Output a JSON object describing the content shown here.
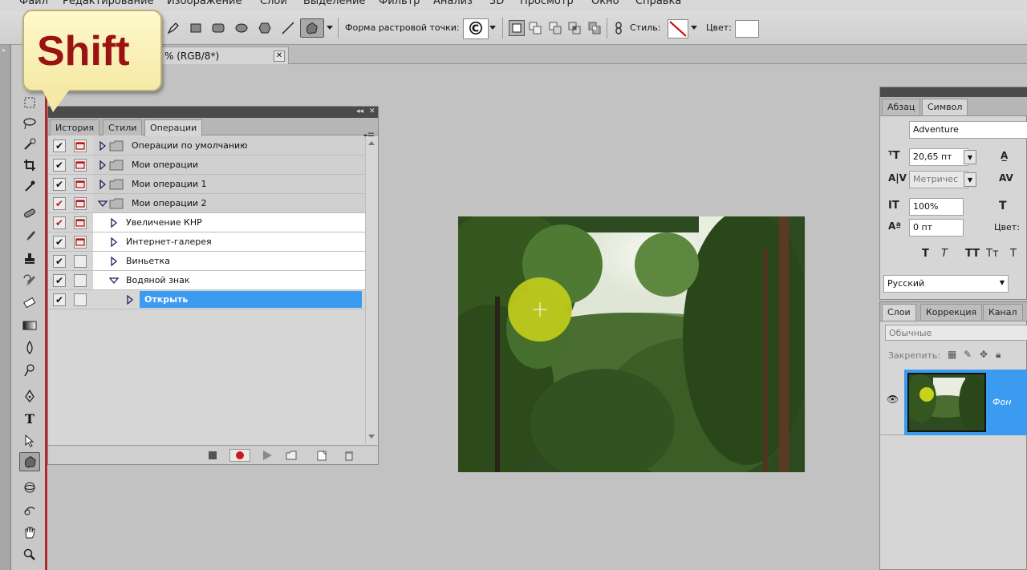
{
  "menu": [
    "Файл",
    "Редактирование",
    "Изображение",
    "Слои",
    "Выделение",
    "Фильтр",
    "Анализ",
    "3D",
    "Просмотр",
    "Окно",
    "Справка"
  ],
  "options_bar": {
    "raster_point_label": "Форма растровой точки:",
    "style_label": "Стиль:",
    "color_label": "Цвет:",
    "shape_icons": [
      "pen-icon",
      "rectangle-icon",
      "rounded-rectangle-icon",
      "ellipse-icon",
      "polygon-icon",
      "line-icon",
      "custom-shape-icon"
    ],
    "copyright_symbol": "©"
  },
  "document_tab": {
    "title": "% (RGB/8*)",
    "close": "✕"
  },
  "callout": {
    "text": "Shift"
  },
  "actions_panel": {
    "tabs": [
      {
        "label": "История"
      },
      {
        "label": "Стили"
      },
      {
        "label": "Операции",
        "active": true
      }
    ],
    "rows": [
      {
        "label": "Операции по умолчанию",
        "level": 0,
        "expanded": false,
        "folder": true,
        "dialog_red": true
      },
      {
        "label": "Мои операции",
        "level": 0,
        "expanded": false,
        "folder": true,
        "dialog_red": true
      },
      {
        "label": "Мои операции 1",
        "level": 0,
        "expanded": false,
        "folder": true,
        "dialog_red": true
      },
      {
        "label": "Мои операции 2",
        "level": 0,
        "expanded": true,
        "folder": true,
        "dialog_red": true,
        "check_red": true
      },
      {
        "label": "Увеличение КНР",
        "level": 1,
        "expanded": false,
        "dialog_red": true,
        "check_red": true
      },
      {
        "label": "Интернет-галерея",
        "level": 1,
        "expanded": false,
        "dialog_red": true
      },
      {
        "label": "Виньетка",
        "level": 1,
        "expanded": false
      },
      {
        "label": "Водяной знак",
        "level": 1,
        "expanded": true
      },
      {
        "label": "Открыть",
        "level": 2,
        "expanded": false,
        "selected": true
      }
    ]
  },
  "character_panel": {
    "tabs": [
      {
        "label": "Абзац"
      },
      {
        "label": "Символ",
        "active": true
      }
    ],
    "font_family": "Adventure",
    "font_size": "20,65 пт",
    "kerning": "Метричес",
    "vertical_scale": "100%",
    "baseline_shift": "0 пт",
    "color_label": "Цвет:",
    "style_buttons": [
      "T",
      "T",
      "TT",
      "Tт",
      "T"
    ],
    "language": "Русский"
  },
  "layers_panel": {
    "tabs": [
      {
        "label": "Слои",
        "active": true
      },
      {
        "label": "Коррекция"
      },
      {
        "label": "Канал"
      }
    ],
    "blend_mode": "Обычные",
    "lock_label": "Закрепить:",
    "layers": [
      {
        "name": "Фон",
        "visible": true,
        "selected": true
      }
    ]
  }
}
